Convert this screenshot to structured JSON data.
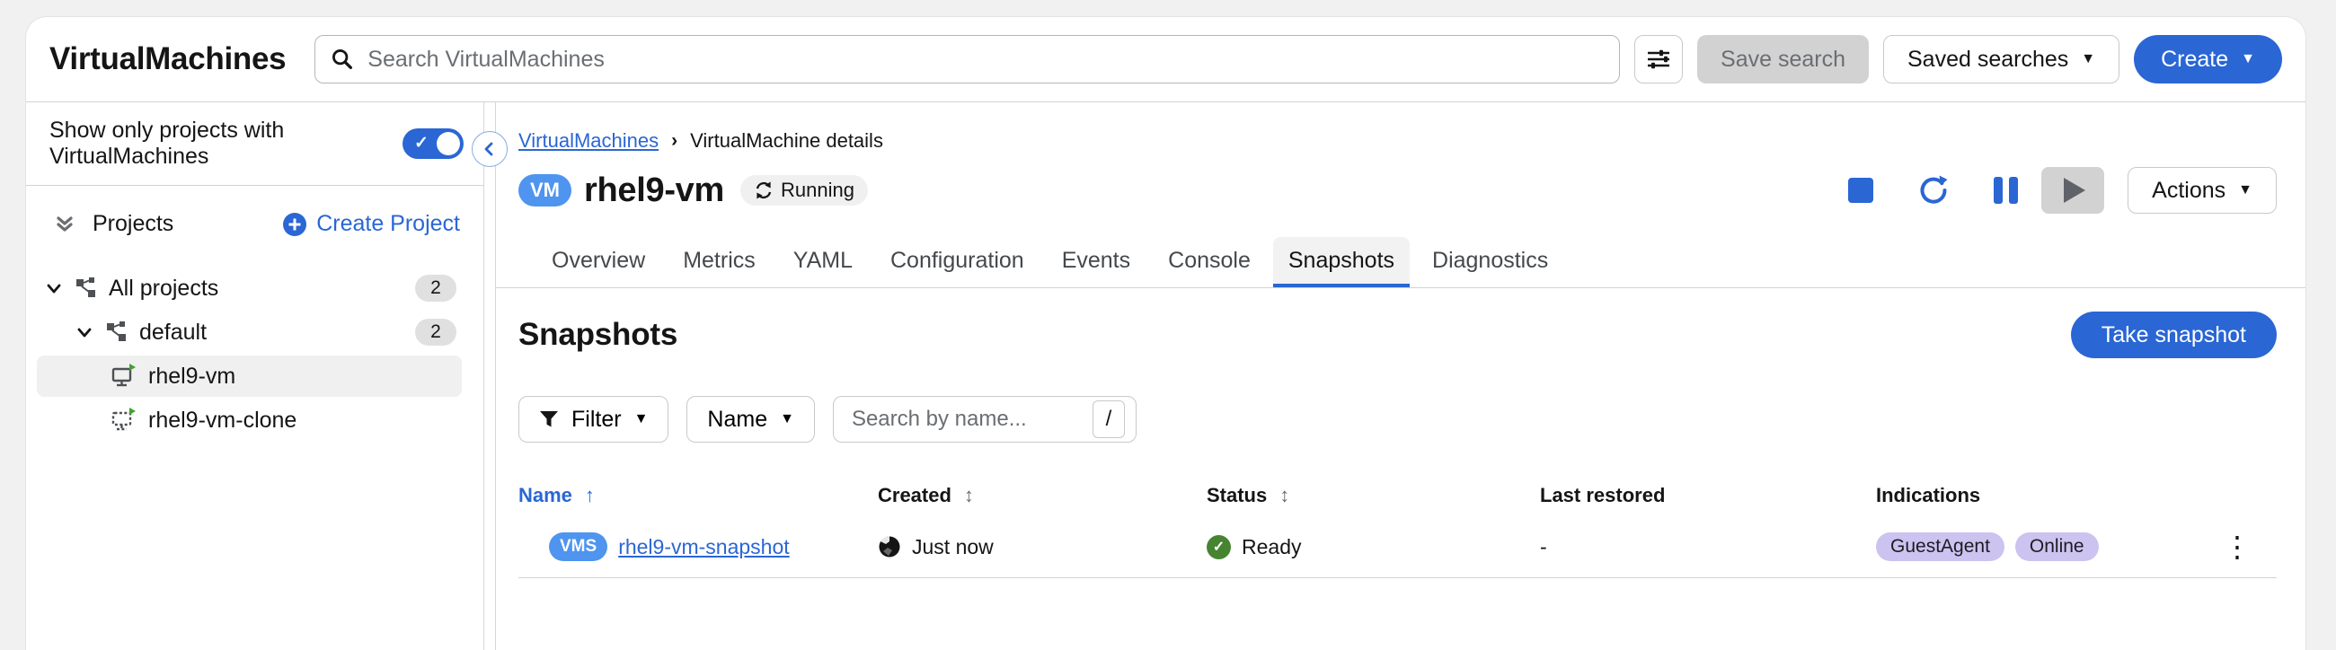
{
  "masthead": {
    "title": "VirtualMachines",
    "search_placeholder": "Search VirtualMachines",
    "save_search_label": "Save search",
    "saved_searches_label": "Saved searches",
    "create_label": "Create"
  },
  "sidebar": {
    "show_only_label": "Show only projects with VirtualMachines",
    "projects_label": "Projects",
    "create_project_label": "Create Project",
    "tree": [
      {
        "label": "All projects",
        "count": "2",
        "type": "project-group",
        "expanded": true
      },
      {
        "label": "default",
        "count": "2",
        "type": "project",
        "expanded": true
      },
      {
        "label": "rhel9-vm",
        "type": "virtual-machine",
        "selected": true
      },
      {
        "label": "rhel9-vm-clone",
        "type": "virtual-machine"
      }
    ]
  },
  "breadcrumb": {
    "root": "VirtualMachines",
    "separator": "›",
    "current": "VirtualMachine details"
  },
  "vm_header": {
    "kind_badge": "VM",
    "name": "rhel9-vm",
    "status": "Running",
    "actions_label": "Actions"
  },
  "tabs": [
    {
      "label": "Overview"
    },
    {
      "label": "Metrics"
    },
    {
      "label": "YAML"
    },
    {
      "label": "Configuration"
    },
    {
      "label": "Events"
    },
    {
      "label": "Console"
    },
    {
      "label": "Snapshots",
      "active": true
    },
    {
      "label": "Diagnostics"
    }
  ],
  "snapshots": {
    "heading": "Snapshots",
    "take_snapshot_label": "Take snapshot",
    "filter_label": "Filter",
    "name_menu_label": "Name",
    "search_placeholder": "Search by name...",
    "kbd_shortcut": "/"
  },
  "table": {
    "columns": [
      "Name",
      "Created",
      "Status",
      "Last restored",
      "Indications"
    ],
    "sort_glyphs": {
      "asc": "↑",
      "both": "↕"
    },
    "rows": [
      {
        "kind_badge": "VMS",
        "name": "rhel9-vm-snapshot",
        "created": "Just now",
        "status": "Ready",
        "last_restored": "-",
        "indications": [
          "GuestAgent",
          "Online"
        ]
      }
    ]
  },
  "icons": {
    "kebab": "⋮",
    "toggle_check": "✓",
    "caret_down": "▼"
  },
  "colors": {
    "primary": "#2a66d4",
    "kind_badge_blue": "#4f94ef",
    "indication_badge": "#ccc3f0",
    "status_green": "#468431",
    "disabled_bg": "#d2d2d2",
    "page_bg": "#f1f1f1"
  }
}
